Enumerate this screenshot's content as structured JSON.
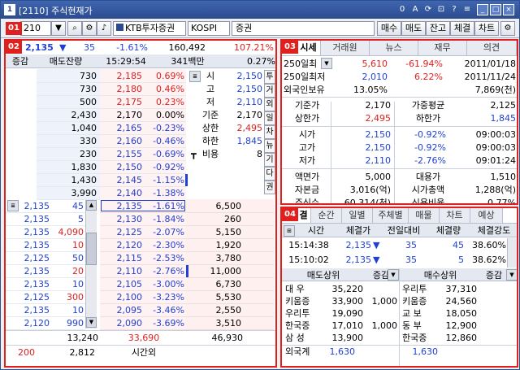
{
  "window": {
    "title": "[2110] 주식현재가"
  },
  "toolbar": {
    "code_value": "210",
    "broker": "KTB투자증권",
    "market": "KOSPI",
    "sector": "증권",
    "buttons": [
      "매수",
      "매도",
      "잔고",
      "체결",
      "차트"
    ]
  },
  "badges": [
    "01",
    "02",
    "03",
    "04"
  ],
  "left": {
    "price": "2,135",
    "arrow": "▼",
    "change": "35",
    "change_pct": "-1.61%",
    "volume": "160,492",
    "vol_ratio": "107.21%",
    "head2": [
      "증감",
      "매도잔량",
      "15:29:54",
      "341백만",
      "0.27%"
    ],
    "ask_rows": [
      {
        "qty": "730",
        "price": "2,185",
        "pct": "0.69%"
      },
      {
        "qty": "730",
        "price": "2,180",
        "pct": "0.46%"
      },
      {
        "qty": "500",
        "price": "2,175",
        "pct": "0.23%"
      },
      {
        "qty": "2,430",
        "price": "2,170",
        "pct": "0.00%"
      },
      {
        "qty": "1,040",
        "price": "2,165",
        "pct": "-0.23%"
      },
      {
        "qty": "330",
        "price": "2,160",
        "pct": "-0.46%"
      },
      {
        "qty": "230",
        "price": "2,155",
        "pct": "-0.69%"
      },
      {
        "qty": "1,830",
        "price": "2,150",
        "pct": "-0.92%"
      },
      {
        "qty": "1,430",
        "price": "2,145",
        "pct": "-1.15%"
      },
      {
        "qty": "3,990",
        "price": "2,140",
        "pct": "-1.38%"
      }
    ],
    "info_labels": [
      "시",
      "고",
      "저",
      "기준",
      "상한",
      "하한",
      "비용"
    ],
    "info_values": [
      "2,150",
      "2,150",
      "2,110",
      "2,170",
      "2,495",
      "1,845",
      "8"
    ],
    "side_buttons": [
      "투",
      "거",
      "외",
      "일",
      "차",
      "뉴",
      "기",
      "다",
      "권"
    ],
    "trades": [
      {
        "price": "2,135",
        "qty": "45"
      },
      {
        "price": "2,135",
        "qty": "5"
      },
      {
        "price": "2,135",
        "qty": "4,090"
      },
      {
        "price": "2,135",
        "qty": "10"
      },
      {
        "price": "2,125",
        "qty": "50"
      },
      {
        "price": "2,135",
        "qty": "20"
      },
      {
        "price": "2,135",
        "qty": "10"
      },
      {
        "price": "2,125",
        "qty": "300"
      },
      {
        "price": "2,135",
        "qty": "10"
      },
      {
        "price": "2,120",
        "qty": "990"
      }
    ],
    "bid_rows": [
      {
        "price": "2,135",
        "pct": "-1.61%",
        "qty": "6,500"
      },
      {
        "price": "2,130",
        "pct": "-1.84%",
        "qty": "260"
      },
      {
        "price": "2,125",
        "pct": "-2.07%",
        "qty": "5,150"
      },
      {
        "price": "2,120",
        "pct": "-2.30%",
        "qty": "1,920"
      },
      {
        "price": "2,115",
        "pct": "-2.53%",
        "qty": "3,780"
      },
      {
        "price": "2,110",
        "pct": "-2.76%",
        "qty": "11,000"
      },
      {
        "price": "2,105",
        "pct": "-3.00%",
        "qty": "6,730"
      },
      {
        "price": "2,100",
        "pct": "-3.23%",
        "qty": "5,530"
      },
      {
        "price": "2,095",
        "pct": "-3.46%",
        "qty": "2,550"
      },
      {
        "price": "2,090",
        "pct": "-3.69%",
        "qty": "3,510"
      }
    ],
    "totals": {
      "ask": "13,240",
      "diff": "33,690",
      "bid": "46,930"
    },
    "after": {
      "a": "200",
      "b": "2,812",
      "label": "시간외"
    }
  },
  "p03": {
    "tabs": [
      "시세",
      "거래원",
      "뉴스",
      "재무",
      "의견"
    ],
    "row1": {
      "label": "250일최",
      "v1": "5,610",
      "v2": "-61.94%",
      "date": "2011/01/18"
    },
    "row2": {
      "label": "250일최저",
      "v1": "2,010",
      "v2": "6.22%",
      "date": "2011/11/24"
    },
    "row3": {
      "label": "외국인보유",
      "v1": "13.05%",
      "v2": "7,869(천)"
    },
    "grid": [
      {
        "l": "기준가",
        "v": "2,170",
        "l2": "가중평균",
        "v2": "2,125"
      },
      {
        "l": "상한가",
        "v": "2,495",
        "l2": "하한가",
        "v2": "1,845"
      }
    ],
    "ohl": [
      {
        "l": "시가",
        "v": "2,150",
        "p": "-0.92%",
        "t": "09:00:03"
      },
      {
        "l": "고가",
        "v": "2,150",
        "p": "-0.92%",
        "t": "09:00:03"
      },
      {
        "l": "저가",
        "v": "2,110",
        "p": "-2.76%",
        "t": "09:01:24"
      }
    ],
    "misc": [
      {
        "l": "액면가",
        "v": "5,000",
        "l2": "대용가",
        "v2": "1,510"
      },
      {
        "l": "자본금",
        "v": "3,016(억)",
        "l2": "시가총액",
        "v2": "1,288(억)"
      },
      {
        "l": "주식수",
        "v": "60,314(천)",
        "l2": "신용비율",
        "v2": "0.77%"
      }
    ]
  },
  "p04": {
    "tabs": [
      "결",
      "순간",
      "일별",
      "주체별",
      "매물",
      "차트",
      "예상"
    ],
    "head": [
      "시간",
      "체결가",
      "전일대비",
      "체결량",
      "체결강도"
    ],
    "rows": [
      {
        "t": "15:14:38",
        "p": "2,135",
        "d": "35",
        "q": "45",
        "s": "38.60%"
      },
      {
        "t": "15:10:02",
        "p": "2,135",
        "d": "35",
        "q": "5",
        "s": "38.62%"
      }
    ],
    "sell_head": "매도상위",
    "buy_head": "매수상위",
    "inc_label": "증감",
    "sell": [
      {
        "n": "대 우",
        "v": "35,220",
        "c": ""
      },
      {
        "n": "키움증",
        "v": "33,900",
        "c": "1,000"
      },
      {
        "n": "우리투",
        "v": "19,090",
        "c": ""
      },
      {
        "n": "한국증",
        "v": "17,010",
        "c": "1,000"
      },
      {
        "n": "삼 성",
        "v": "13,900",
        "c": ""
      }
    ],
    "buy": [
      {
        "n": "우리투",
        "v": "37,310"
      },
      {
        "n": "키움증",
        "v": "24,560"
      },
      {
        "n": "교 보",
        "v": "18,050"
      },
      {
        "n": "동 부",
        "v": "12,900"
      },
      {
        "n": "한국증",
        "v": "12,860"
      }
    ],
    "foreign": {
      "label": "외국계",
      "sell": "1,630",
      "buy": "1,630"
    }
  }
}
